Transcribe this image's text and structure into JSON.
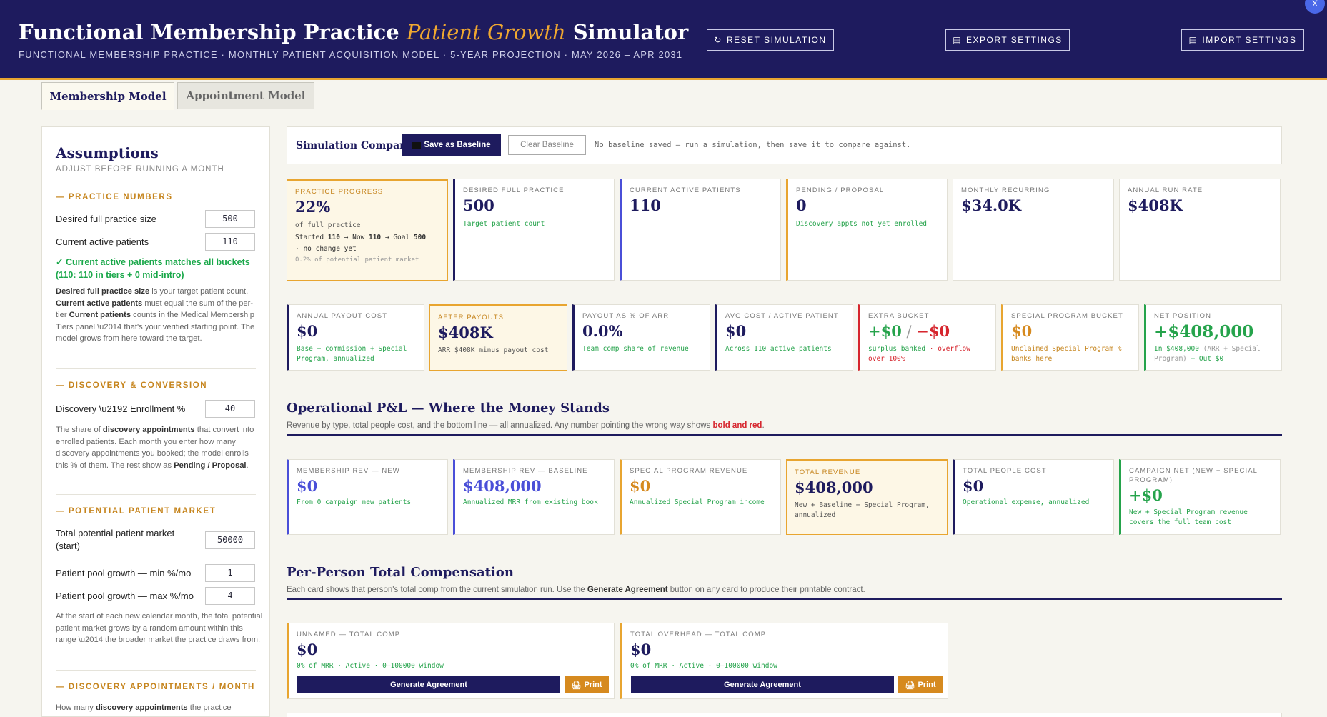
{
  "header": {
    "title_a": "Functional Membership Practice ",
    "title_em": "Patient Growth",
    "title_b": " Simulator",
    "subtitle": "FUNCTIONAL MEMBERSHIP PRACTICE · MONTHLY PATIENT ACQUISITION MODEL · 5-YEAR PROJECTION · MAY 2026 – APR 2031",
    "reset": "RESET SIMULATION",
    "export": "EXPORT SETTINGS",
    "import": "IMPORT SETTINGS",
    "close": "X"
  },
  "tabs": [
    "Membership Model",
    "Appointment Model"
  ],
  "side": {
    "title": "Assumptions",
    "subtitle": "ADJUST BEFORE RUNNING A MONTH",
    "sec1": "— PRACTICE NUMBERS",
    "l_desired": "Desired full practice size",
    "v_desired": "500",
    "l_current": "Current active patients",
    "v_current": "110",
    "ok": "✓ Current active patients matches all buckets (110: 110 in tiers + 0 mid-intro)",
    "p1_b1": "Desired full practice size",
    "p1_t1": " is your target patient count. ",
    "p1_b2": "Current active patients",
    "p1_t2": " must equal the sum of the per-tier ",
    "p1_b3": "Current patients",
    "p1_t3": " counts in the Medical Membership Tiers panel \\u2014 that's your verified starting point. The model grows from here toward the target.",
    "sec2": "— DISCOVERY & CONVERSION",
    "l_enroll": "Discovery \\u2192 Enrollment %",
    "v_enroll": "40",
    "p2_t1": "The share of ",
    "p2_b1": "discovery appointments",
    "p2_t2": " that convert into enrolled patients. Each month you enter how many discovery appointments you booked; the model enrolls this % of them. The rest show as ",
    "p2_b2": "Pending / Proposal",
    "p2_t3": ".",
    "sec3": "— POTENTIAL PATIENT MARKET",
    "l_market": "Total potential patient market (start)",
    "v_market": "50000",
    "l_min": "Patient pool growth — min %/mo",
    "v_min": "1",
    "l_max": "Patient pool growth — max %/mo",
    "v_max": "4",
    "p3": "At the start of each new calendar month, the total potential patient market grows by a random amount within this range \\u2014 the broader market the practice draws from.",
    "sec4": "— DISCOVERY APPOINTMENTS / MONTH",
    "p4_t1": "How many ",
    "p4_b1": "discovery appointments",
    "p4_t2": " the practice"
  },
  "compare": {
    "title": "Simulation Compare",
    "save": "Save as Baseline",
    "clear": "Clear Baseline",
    "note": "No baseline saved — run a simulation, then save it to compare against."
  },
  "row1": [
    {
      "k": "PRACTICE PROGRESS",
      "v": "22%",
      "s1": "of full practice",
      "s2a": "Started ",
      "s2b": "110",
      "s2c": " → Now ",
      "s2d": "110",
      "s2e": " → Goal ",
      "s2f": "500",
      "s3": "· no change yet",
      "s4": "0.2% of potential patient market"
    },
    {
      "k": "DESIRED FULL PRACTICE",
      "v": "500",
      "s": "Target patient count"
    },
    {
      "k": "CURRENT ACTIVE PATIENTS",
      "v": "110",
      "s": ""
    },
    {
      "k": "PENDING / PROPOSAL",
      "v": "0",
      "s": "Discovery appts not yet enrolled"
    },
    {
      "k": "MONTHLY RECURRING",
      "v": "$34.0K",
      "s": ""
    },
    {
      "k": "ANNUAL RUN RATE",
      "v": "$408K",
      "s": ""
    }
  ],
  "row2": [
    {
      "k": "ANNUAL PAYOUT COST",
      "v": "$0",
      "s1": "Base + commission + Special",
      "s2": "Program, annualized"
    },
    {
      "k": "AFTER PAYOUTS",
      "v": "$408K",
      "s1": "ARR $408K minus payout cost",
      "s2": ""
    },
    {
      "k": "PAYOUT AS % OF ARR",
      "v": "0.0%",
      "s1": "Team comp share of revenue",
      "s2": ""
    },
    {
      "k": "AVG COST / ACTIVE PATIENT",
      "v": "$0",
      "s1": "Across 110 active patients",
      "s2": ""
    },
    {
      "k": "EXTRA BUCKET",
      "va": "+$0",
      "vsep": " / ",
      "vb": "−$0",
      "s1a": "surplus banked",
      "s1b": " · overflow",
      "s2": "over 100%"
    },
    {
      "k": "SPECIAL PROGRAM BUCKET",
      "v": "$0",
      "s1": "Unclaimed Special Program %",
      "s2": "banks here"
    },
    {
      "k": "NET POSITION",
      "v": "+$408,000",
      "s1a": "In $408,000 ",
      "s1b": "(ARR + Special",
      "s2a": "Program)",
      "s2b": " − Out $0"
    }
  ],
  "pl": {
    "title": "Operational P&L — Where the Money Stands",
    "sub_a": "Revenue by type, total people cost, and the bottom line — all annualized. Any number pointing the wrong way shows ",
    "sub_b": "bold and red",
    "sub_c": ".",
    "cards": [
      {
        "k": "MEMBERSHIP REV — NEW",
        "v": "$0",
        "s1": "From 0 campaign new patients",
        "s2": ""
      },
      {
        "k": "MEMBERSHIP REV — BASELINE",
        "v": "$408,000",
        "s1": "Annualized MRR from existing book",
        "s2": ""
      },
      {
        "k": "SPECIAL PROGRAM REVENUE",
        "v": "$0",
        "s1": "Annualized Special Program income",
        "s2": ""
      },
      {
        "k": "TOTAL REVENUE",
        "v": "$408,000",
        "s1": "New + Baseline + Special Program,",
        "s2": "annualized"
      },
      {
        "k": "TOTAL PEOPLE COST",
        "v": "$0",
        "s1": "Operational expense, annualized",
        "s2": ""
      },
      {
        "k1": "CAMPAIGN NET (NEW + SPECIAL",
        "k2": "PROGRAM)",
        "v": "+$0",
        "s1": "New + Special Program revenue",
        "s2": "covers the full team cost"
      }
    ]
  },
  "comp": {
    "title": "Per-Person Total Compensation",
    "sub_a": "Each card shows that person's total comp from the current simulation run. Use the ",
    "sub_b": "Generate Agreement",
    "sub_c": " button on any card to produce their printable contract.",
    "cards": [
      {
        "k": "UNNAMED — TOTAL COMP",
        "v": "$0",
        "s": "0% of MRR · Active · 0–100000 window",
        "gen": "Generate Agreement",
        "print": "Print"
      },
      {
        "k": "TOTAL OVERHEAD — TOTAL COMP",
        "v": "$0",
        "s": "0% of MRR · Active · 0–100000 window",
        "gen": "Generate Agreement",
        "print": "Print"
      }
    ]
  },
  "colors": {
    "navy": "#1e1b5e",
    "gold": "#e8a530",
    "green": "#25a34b",
    "red": "#d6262e",
    "blue": "#4a4fd8"
  }
}
